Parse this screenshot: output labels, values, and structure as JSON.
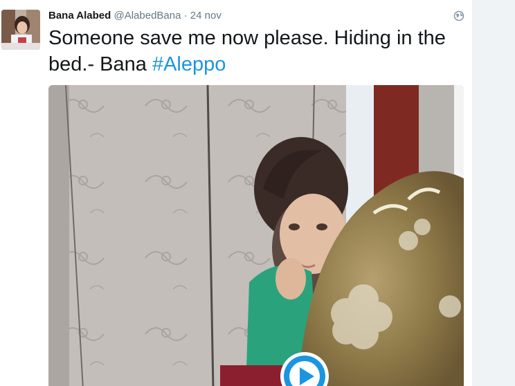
{
  "tweet": {
    "author_name": "Bana Alabed",
    "author_handle": "@AlabedBana",
    "separator": "·",
    "date": "24 nov",
    "text_main": "Someone save me now please. Hiding in the bed.- Bana ",
    "hashtag": "#Aleppo",
    "icons": {
      "avatar": "avatar-photo",
      "globe": "globe-icon",
      "play": "play-icon"
    },
    "colors": {
      "hashtag": "#1b95e0",
      "play_button": "#1b95e0",
      "name": "#14171a",
      "meta": "#657786"
    }
  }
}
